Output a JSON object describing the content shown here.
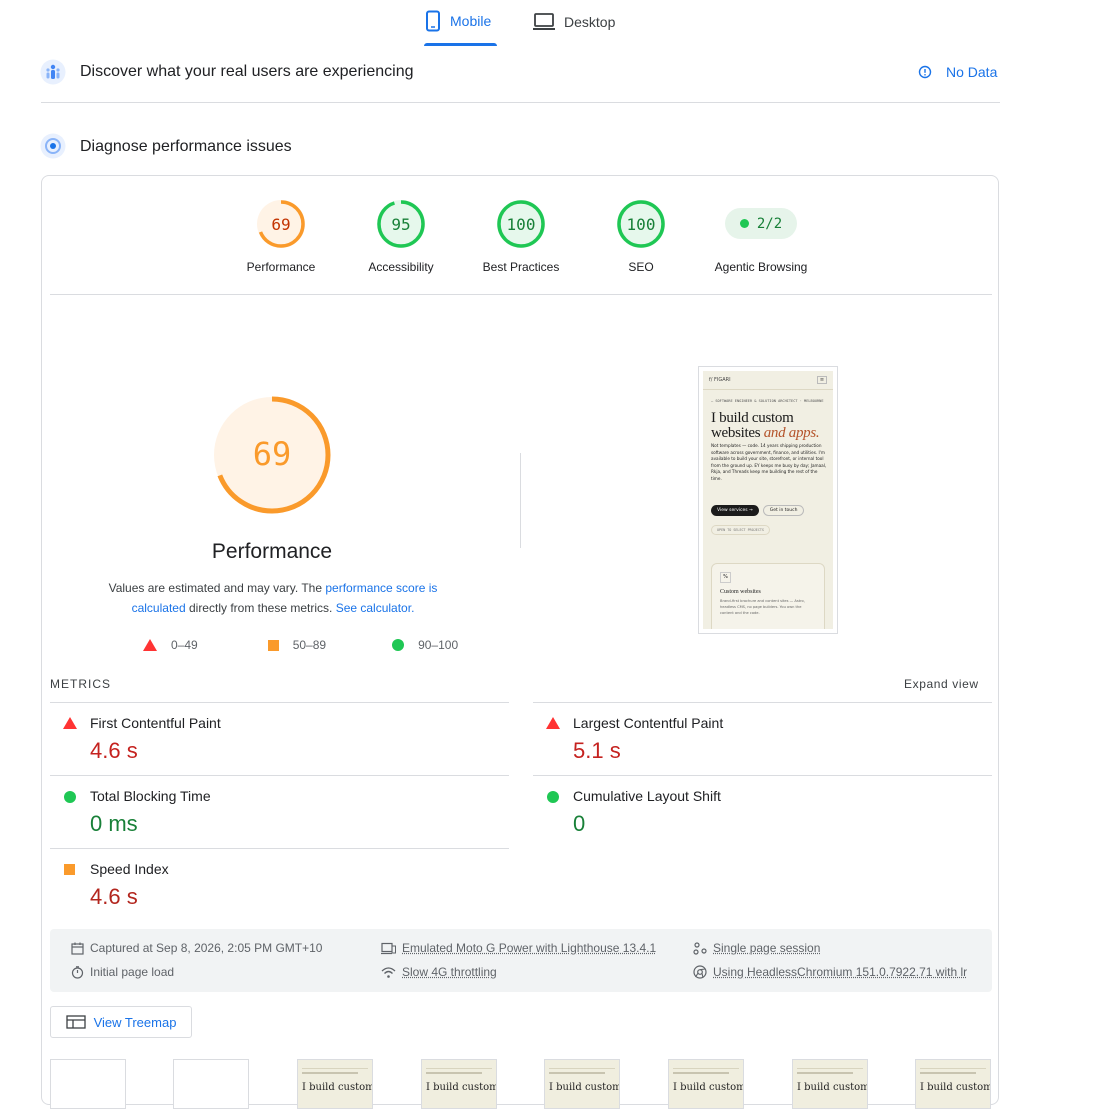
{
  "tabs": {
    "mobile": "Mobile",
    "desktop": "Desktop"
  },
  "field": {
    "title": "Discover what your real users are experiencing",
    "status": "No Data"
  },
  "lab": {
    "title": "Diagnose performance issues"
  },
  "categories": [
    {
      "label": "Performance",
      "score": "69",
      "value": 0.69,
      "color": "#fa9a2b",
      "text": "#c33300",
      "bg": "#fff3e6"
    },
    {
      "label": "Accessibility",
      "score": "95",
      "value": 0.95,
      "color": "#1fc754",
      "text": "#188038",
      "bg": "#e6f8ec"
    },
    {
      "label": "Best Practices",
      "score": "100",
      "value": 1.0,
      "color": "#1fc754",
      "text": "#188038",
      "bg": "#e6f8ec"
    },
    {
      "label": "SEO",
      "score": "100",
      "value": 1.0,
      "color": "#1fc754",
      "text": "#188038",
      "bg": "#e6f8ec"
    }
  ],
  "agentic": {
    "label": "Agentic Browsing",
    "badge": "2/2"
  },
  "big_gauge": {
    "score": "69",
    "value": 0.69,
    "label": "Performance"
  },
  "disclaimer": {
    "part1": "Values are estimated and may vary. The ",
    "link1": "performance score is calculated",
    "part2": " directly from these metrics. ",
    "link2": "See calculator."
  },
  "legend": {
    "poor": "0–49",
    "average": "50–89",
    "good": "90–100"
  },
  "metrics_header": {
    "title": "METRICS",
    "toggle": "Expand view"
  },
  "metrics": {
    "fcp": {
      "name": "First Contentful Paint",
      "value": "4.6 s"
    },
    "lcp": {
      "name": "Largest Contentful Paint",
      "value": "5.1 s"
    },
    "tbt": {
      "name": "Total Blocking Time",
      "value": "0 ms"
    },
    "cls": {
      "name": "Cumulative Layout Shift",
      "value": "0"
    },
    "si": {
      "name": "Speed Index",
      "value": "4.6 s"
    }
  },
  "runtime": {
    "captured": "Captured at Sep 8, 2026, 2:05 PM GMT+10",
    "load": "Initial page load",
    "device": "Emulated Moto G Power with Lighthouse 13.4.1",
    "throttling": "Slow 4G throttling",
    "session": "Single page session",
    "browser": "Using HeadlessChromium 151.0.7922.71 with lr"
  },
  "treemap": {
    "label": "View Treemap"
  },
  "screenshot": {
    "nav_brand": "f/ FIGARI",
    "kicker": "— SOFTWARE ENGINEER & SOLUTION ARCHITECT · MELBOURNE",
    "headline1": "I build custom",
    "headline2": "websites ",
    "headline_accent": "and apps.",
    "body": "Not templates — code. 14 years shipping production software across government, finance, and utilities. I'm available to build your site, storefront, or internal tool from the ground up. EY keeps me busy by day; Jamaal, Rkja, and Threads keep me building the rest of the time.",
    "cta_primary": "View services →",
    "cta_secondary": "Get in touch",
    "pill": "OPEN TO SELECT PROJECTS",
    "card_title": "Custom websites",
    "card_body": "Brand-first brochure and content sites — Astro, headless CMS, no page builders. You own the content and the code.",
    "accent": "#b4532a"
  },
  "filmstrip_text": "I build custom",
  "colors": {
    "blue": "#1a73e8",
    "red": "#c5221f",
    "green": "#0cce6b",
    "orange": "#fa9a2b"
  }
}
